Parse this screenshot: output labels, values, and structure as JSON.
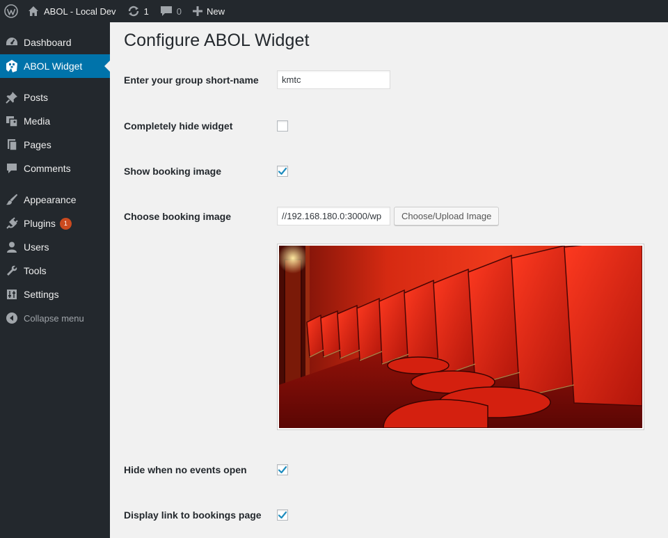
{
  "adminbar": {
    "site_name": "ABOL - Local Dev",
    "updates_count": "1",
    "comments_count": "0",
    "new_label": "New"
  },
  "sidebar": {
    "items": [
      {
        "label": "Dashboard",
        "icon": "dashboard-icon"
      },
      {
        "label": "ABOL Widget",
        "icon": "abol-widget-icon",
        "current": true
      },
      {
        "label": "Posts",
        "icon": "pushpin-icon"
      },
      {
        "label": "Media",
        "icon": "media-icon"
      },
      {
        "label": "Pages",
        "icon": "pages-icon"
      },
      {
        "label": "Comments",
        "icon": "comment-icon"
      },
      {
        "label": "Appearance",
        "icon": "brush-icon"
      },
      {
        "label": "Plugins",
        "icon": "plugin-icon",
        "badge": "1"
      },
      {
        "label": "Users",
        "icon": "user-icon"
      },
      {
        "label": "Tools",
        "icon": "wrench-icon"
      },
      {
        "label": "Settings",
        "icon": "sliders-icon"
      }
    ],
    "collapse_label": "Collapse menu"
  },
  "main": {
    "title": "Configure ABOL Widget",
    "fields": {
      "short_name": {
        "label": "Enter your group short-name",
        "value": "kmtc"
      },
      "hide_widget": {
        "label": "Completely hide widget",
        "checked": false
      },
      "show_booking_image": {
        "label": "Show booking image",
        "checked": true
      },
      "booking_image": {
        "label": "Choose booking image",
        "value": "//192.168.180.0:3000/wp",
        "button_label": "Choose/Upload Image"
      },
      "hide_no_events": {
        "label": "Hide when no events open",
        "checked": true
      },
      "display_link": {
        "label": "Display link to bookings page",
        "checked": true
      }
    }
  },
  "colors": {
    "sidebar_bg": "#23282d",
    "accent": "#0073aa",
    "badge": "#ca4a1f",
    "checkmark": "#1e8cbe"
  }
}
